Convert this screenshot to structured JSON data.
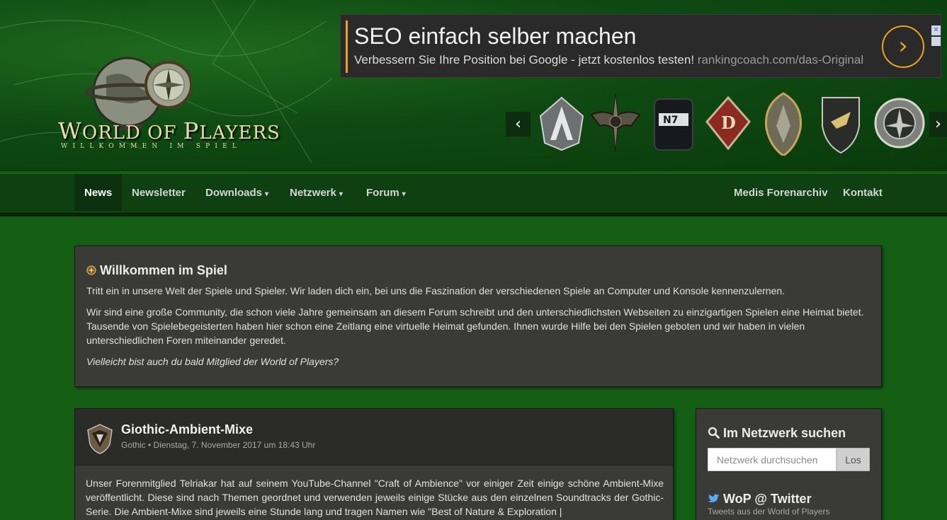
{
  "header": {
    "logo": {
      "title_cap1": "W",
      "title_rest1": "ORLD OF ",
      "title_cap2": "P",
      "title_rest2": "LAYERS",
      "subtitle": "WILLKOMMEN IM SPIEL"
    },
    "ad": {
      "title": "SEO einfach selber machen",
      "description": "Verbessern Sie Ihre Position bei Google - jetzt kostenlos testen!",
      "url": "rankingcoach.com/das-Original",
      "arrow": "›",
      "close": "✕",
      "accent_color": "#e8a41c"
    },
    "carousel": {
      "prev": "‹",
      "next": "›",
      "games": [
        "assassins-creed-emblem-icon",
        "winged-emblem-icon",
        "n7-emblem-icon",
        "diablo-emblem-icon",
        "elder-scrolls-shield-icon",
        "gothic-shield-icon",
        "witcher-medallion-icon"
      ]
    }
  },
  "nav": {
    "items": [
      {
        "label": "News"
      },
      {
        "label": "Newsletter"
      },
      {
        "label": "Downloads"
      },
      {
        "label": "Netzwerk"
      },
      {
        "label": "Forum"
      },
      {
        "label": "Medis Forenarchiv"
      },
      {
        "label": "Kontakt"
      }
    ],
    "caret": "▾"
  },
  "welcome": {
    "title": "Willkommen im Spiel",
    "p1": "Tritt ein in unsere Welt der Spiele und Spieler. Wir laden dich ein, bei uns die Faszination der verschiedenen Spiele an Computer und Konsole kennenzulernen.",
    "p2": "Wir sind eine große Community, die schon viele Jahre gemeinsam an diesem Forum schreibt und den unterschiedlichsten Webseiten zu einzigartigen Spielen eine Heimat bietet. Tausende von Spielebegeisterten haben hier schon eine Zeitlang eine virtuelle Heimat gefunden. Ihnen wurde Hilfe bei den Spielen geboten und wir haben in vielen unterschiedlichen Foren miteinander geredet.",
    "p3": "Vielleicht bist auch du bald Mitglied der World of Players?"
  },
  "article": {
    "title": "Giothic-Ambient-Mixe",
    "meta": "Gothic • Dienstag, 7. November 2017 um 18:43 Uhr",
    "body": "Unser Forenmitglied Telriakar hat auf seinem YouTube-Channel \"Craft of Ambience\" vor einiger Zeit einige schöne Ambient-Mixe veröffentlicht. Diese sind nach Themen geordnet und verwenden jeweils einige Stücke aus den einzelnen Soundtracks der Gothic-Serie. Die Ambient-Mixe sind jeweils eine Stunde lang und tragen Namen wie \"Best of Nature & Exploration |"
  },
  "sidebar": {
    "search_title": "Im Netzwerk suchen",
    "search_placeholder": "Netzwerk durchsuchen",
    "search_button": "Los",
    "twitter_title": "WoP @ Twitter",
    "twitter_sub": "Tweets aus der World of Players",
    "twitter_color": "#55acee"
  }
}
